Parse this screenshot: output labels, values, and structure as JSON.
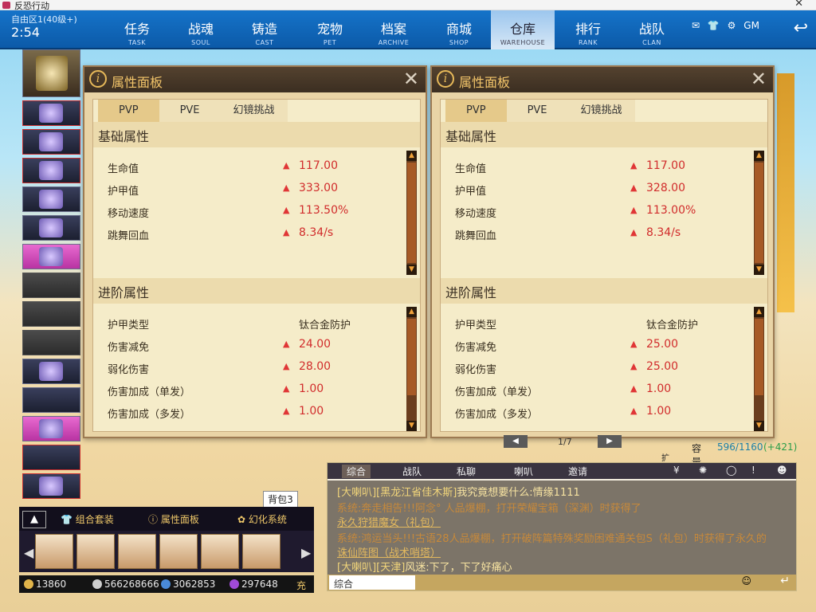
{
  "window": {
    "title": "反恐行动"
  },
  "topbar": {
    "server": "自由区1(40级+)",
    "clock": "2:54",
    "nav": [
      {
        "cn": "任务",
        "en": "TASK"
      },
      {
        "cn": "战魂",
        "en": "SOUL"
      },
      {
        "cn": "铸造",
        "en": "CAST"
      },
      {
        "cn": "宠物",
        "en": "PET"
      },
      {
        "cn": "档案",
        "en": "ARCHIVE"
      },
      {
        "cn": "商城",
        "en": "SHOP"
      },
      {
        "cn": "仓库",
        "en": "WAREHOUSE"
      },
      {
        "cn": "排行",
        "en": "RANK"
      },
      {
        "cn": "战队",
        "en": "CLAN"
      }
    ],
    "active_nav": "仓库",
    "gm_label": "GM"
  },
  "panels": [
    {
      "title": "属性面板",
      "tabs": [
        "PVP",
        "PVE",
        "幻镜挑战"
      ],
      "basic_title": "基础属性",
      "basic": [
        {
          "k": "生命值",
          "v": "117.00"
        },
        {
          "k": "护甲值",
          "v": "333.00"
        },
        {
          "k": "移动速度",
          "v": "113.50%"
        },
        {
          "k": "跳舞回血",
          "v": "8.34/s"
        }
      ],
      "adv_title": "进阶属性",
      "adv": [
        {
          "k": "护甲类型",
          "v": "钛合金防护",
          "plain": true
        },
        {
          "k": "伤害减免",
          "v": "24.00"
        },
        {
          "k": "弱化伤害",
          "v": "28.00"
        },
        {
          "k": "伤害加成（单发）",
          "v": "1.00"
        },
        {
          "k": "伤害加成（多发）",
          "v": "1.00"
        }
      ]
    },
    {
      "title": "属性面板",
      "tabs": [
        "PVP",
        "PVE",
        "幻镜挑战"
      ],
      "basic_title": "基础属性",
      "basic": [
        {
          "k": "生命值",
          "v": "117.00"
        },
        {
          "k": "护甲值",
          "v": "328.00"
        },
        {
          "k": "移动速度",
          "v": "113.00%"
        },
        {
          "k": "跳舞回血",
          "v": "8.34/s"
        }
      ],
      "adv_title": "进阶属性",
      "adv": [
        {
          "k": "护甲类型",
          "v": "钛合金防护",
          "plain": true
        },
        {
          "k": "伤害减免",
          "v": "25.00"
        },
        {
          "k": "弱化伤害",
          "v": "25.00"
        },
        {
          "k": "伤害加成（单发）",
          "v": "1.00"
        },
        {
          "k": "伤害加成（多发）",
          "v": "1.00"
        }
      ]
    }
  ],
  "bag": {
    "label": "背包3",
    "bar": [
      "组合套装",
      "属性面板",
      "幻化系统"
    ]
  },
  "resources": {
    "gold": "13860",
    "silver": "566268666",
    "m": "3062853",
    "purple": "297648",
    "charge": "充"
  },
  "warehouse": {
    "page": "1/7",
    "capacity_label": "容量",
    "capacity": "596/1160",
    "bonus": "(+421)",
    "expand": "扩容"
  },
  "chat": {
    "tabs": [
      "综合",
      "战队",
      "私聊",
      "喇叭",
      "邀请"
    ],
    "messages": [
      {
        "prefix": "[大喇叭][黑龙江省佳木斯]",
        "text": "我究竟想要什么:情缘1111"
      },
      {
        "prefix": "系统:",
        "text": "奔走相告!!!阿念° 人品爆棚，打开荣耀宝箱（深渊）时获得了",
        "link": "永久狩猎魔女（礼包）"
      },
      {
        "prefix": "系统:",
        "text": "鸿运当头!!!古语28人品爆棚，打开破阵篇特殊奖励困难通关包S（礼包）时获得了永久的",
        "link": "诛仙阵图（战术哨塔）"
      },
      {
        "prefix": "[大喇叭][天津]",
        "text": "风迷:下了，下了好痛心"
      }
    ],
    "input_channel": "综合"
  }
}
